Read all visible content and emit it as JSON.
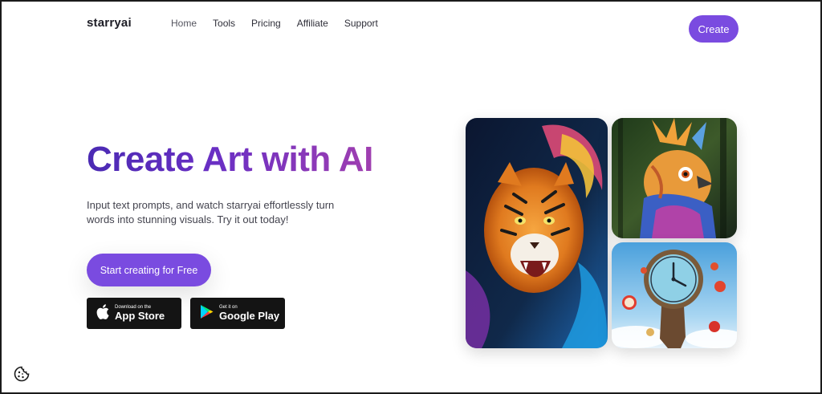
{
  "nav": {
    "logo": "starryai",
    "links": [
      "Home",
      "Tools",
      "Pricing",
      "Affiliate",
      "Support"
    ],
    "create_label": "Create"
  },
  "hero": {
    "title": "Create Art with AI",
    "subtitle": "Input text prompts, and watch starryai effortlessly turn words into stunning visuals. Try it out today!",
    "cta_label": "Start creating for Free"
  },
  "stores": {
    "apple": {
      "small": "Download on the",
      "big": "App Store"
    },
    "google": {
      "small": "Get it on",
      "big": "Google Play"
    }
  },
  "gallery": [
    "tiger-artwork",
    "bird-artwork",
    "clock-artwork"
  ],
  "colors": {
    "accent": "#7a4be0",
    "title_start": "#4a2ab3",
    "title_end": "#a03fb0"
  }
}
